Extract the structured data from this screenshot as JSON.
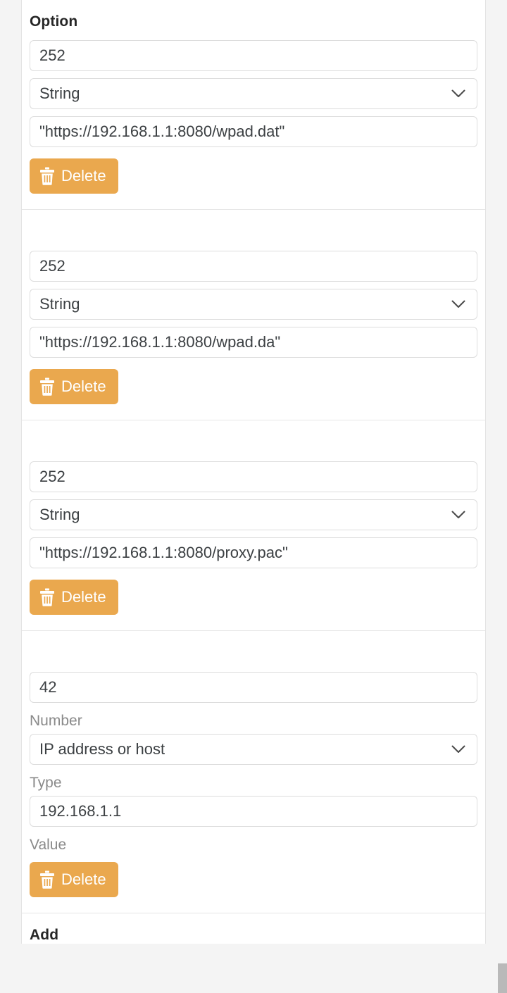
{
  "panel": {
    "heading": "Option",
    "add_heading": "Add",
    "accent_color": "#eaa84e",
    "background_color": "#f4f4f4",
    "card_background": "#ffffff",
    "border_color": "#e6e6e6"
  },
  "labels": {
    "number": "Number",
    "type": "Type",
    "value": "Value"
  },
  "icons": {
    "delete": "trash-icon",
    "dropdown": "chevron-down-icon"
  },
  "options": [
    {
      "heading": "Option",
      "show_heading": true,
      "show_sublabels": false,
      "number": "252",
      "type": "String",
      "value": "\"https://192.168.1.1:8080/wpad.dat\"",
      "delete_label": "Delete"
    },
    {
      "heading": "",
      "show_heading": false,
      "show_sublabels": false,
      "number": "252",
      "type": "String",
      "value": "\"https://192.168.1.1:8080/wpad.da\"",
      "delete_label": "Delete"
    },
    {
      "heading": "",
      "show_heading": false,
      "show_sublabels": false,
      "number": "252",
      "type": "String",
      "value": "\"https://192.168.1.1:8080/proxy.pac\"",
      "delete_label": "Delete"
    },
    {
      "heading": "",
      "show_heading": false,
      "show_sublabels": true,
      "number": "42",
      "type": "IP address or host",
      "value": "192.168.1.1",
      "delete_label": "Delete"
    }
  ]
}
